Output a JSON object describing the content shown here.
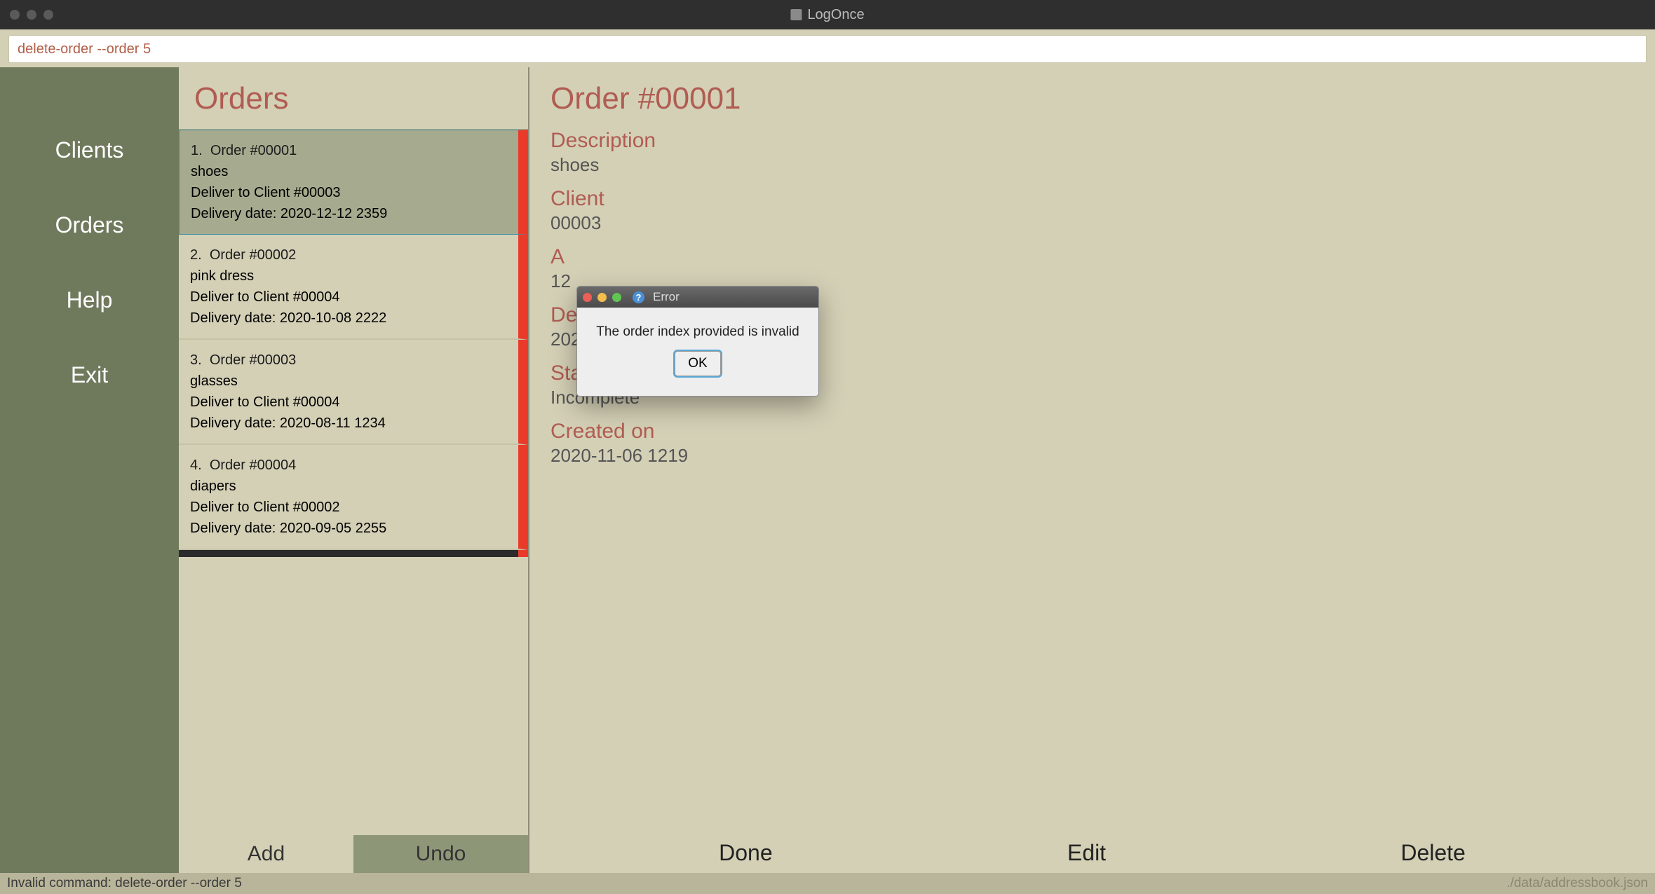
{
  "window": {
    "title": "LogOnce"
  },
  "command_input": "delete-order --order 5",
  "sidebar": {
    "items": [
      {
        "label": "Clients"
      },
      {
        "label": "Orders"
      },
      {
        "label": "Help"
      },
      {
        "label": "Exit"
      }
    ]
  },
  "orders_panel": {
    "header": "Orders",
    "add_label": "Add",
    "undo_label": "Undo",
    "rows": [
      {
        "num": "1.",
        "title": "Order #00001",
        "desc": "shoes",
        "deliver": "Deliver to Client #00003",
        "date": "Delivery date: 2020-12-12 2359",
        "selected": true
      },
      {
        "num": "2.",
        "title": "Order #00002",
        "desc": "pink dress",
        "deliver": "Deliver to Client #00004",
        "date": "Delivery date: 2020-10-08 2222",
        "selected": false
      },
      {
        "num": "3.",
        "title": "Order #00003",
        "desc": "glasses",
        "deliver": "Deliver to Client #00004",
        "date": "Delivery date: 2020-08-11 1234",
        "selected": false
      },
      {
        "num": "4.",
        "title": "Order #00004",
        "desc": "diapers",
        "deliver": "Deliver to Client #00002",
        "date": "Delivery date: 2020-09-05 2255",
        "selected": false
      }
    ]
  },
  "detail": {
    "title": "Order #00001",
    "description_label": "Description",
    "description_value": "shoes",
    "client_label": "Client",
    "client_value": "00003",
    "address_label": "A",
    "address_value": "12",
    "delivery_label": "Delivery date",
    "delivery_value": "2020-12-12 2359",
    "status_label": "Status",
    "status_value": "Incomplete",
    "created_label": "Created on",
    "created_value": "2020-11-06 1219",
    "done_label": "Done",
    "edit_label": "Edit",
    "delete_label": "Delete"
  },
  "modal": {
    "title": "Error",
    "message": "The order index provided is invalid",
    "ok_label": "OK"
  },
  "statusbar": {
    "left": "Invalid command: delete-order --order 5",
    "right": "./data/addressbook.json"
  }
}
